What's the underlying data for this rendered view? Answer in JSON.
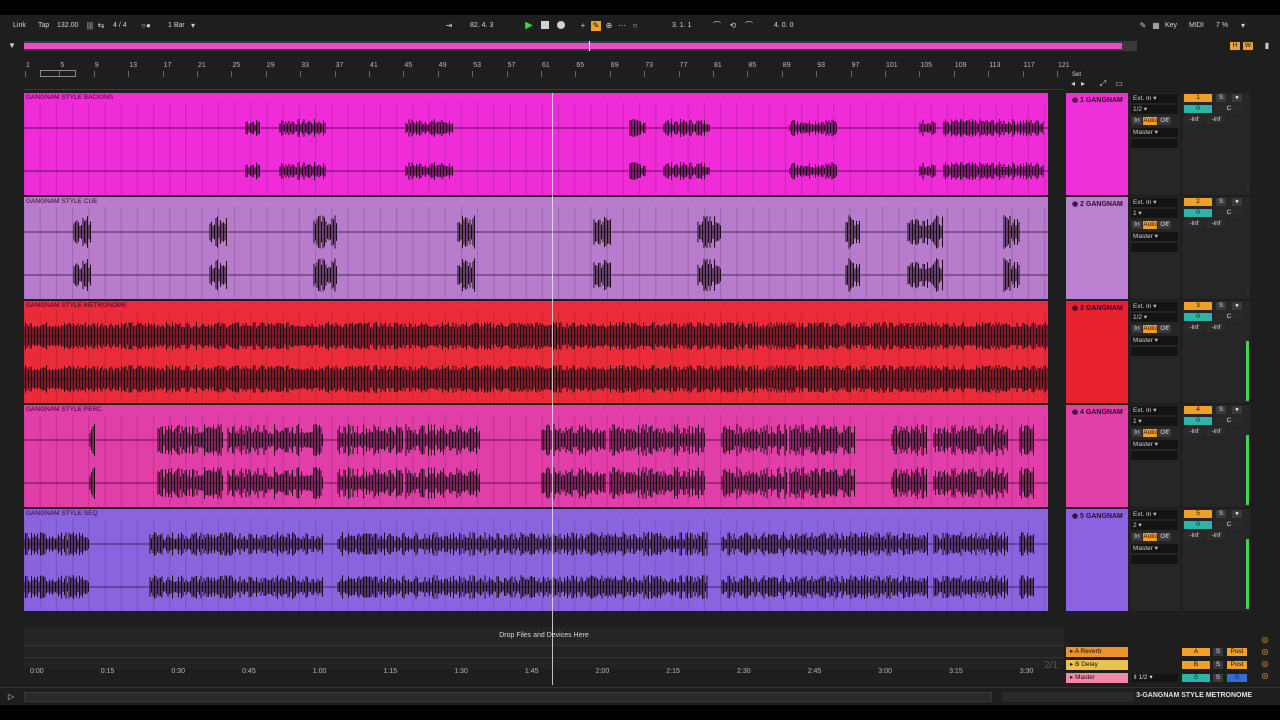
{
  "control_bar": {
    "link": "Link",
    "tap": "Tap",
    "tempo": "132.00",
    "signature": "4 / 4",
    "quantize": "1 Bar",
    "position": "82.  4.  3",
    "loop_start": "3.  1.  1",
    "loop_length": "4.  0.  0",
    "key": "Key",
    "midi": "MIDI",
    "cpu": "7 %"
  },
  "overview_markers": {
    "h": "H",
    "w": "W"
  },
  "ruler": {
    "bars": [
      "1",
      "5",
      "9",
      "13",
      "17",
      "21",
      "25",
      "29",
      "33",
      "37",
      "41",
      "45",
      "49",
      "53",
      "57",
      "61",
      "65",
      "69",
      "73",
      "77",
      "81",
      "85",
      "89",
      "93",
      "97",
      "101",
      "105",
      "109",
      "113",
      "117",
      "121"
    ]
  },
  "set_label": "Set",
  "tracks": [
    {
      "clip_title": "GANGNAM STYLE BACKING",
      "header": "1 GANGNAM",
      "input": "Ext. In",
      "channel": "1/2",
      "monitor": [
        "In",
        "Auto",
        "Off"
      ],
      "output": "Master",
      "number": "1",
      "vol": "0",
      "pan": "C",
      "level_left": "-inf",
      "level_right": "-inf",
      "color": "#ef2cd8",
      "header_color": "#ee31d6"
    },
    {
      "clip_title": "GANGNAM STYLE CUE",
      "header": "2 GANGNAM",
      "input": "Ext. In",
      "channel": "1",
      "monitor": [
        "In",
        "Auto",
        "Off"
      ],
      "output": "Master",
      "number": "2",
      "vol": "0",
      "pan": "C",
      "level_left": "-inf",
      "level_right": "-inf",
      "color": "#b77ccc",
      "header_color": "#bb80cf"
    },
    {
      "clip_title": "GANGNAM STYLE METRONOME",
      "header": "3 GANGNAM",
      "input": "Ext. In",
      "channel": "1/2",
      "monitor": [
        "In",
        "Auto",
        "Off"
      ],
      "output": "Master",
      "number": "3",
      "vol": "0",
      "pan": "C",
      "level_left": "-inf",
      "level_right": "-inf",
      "color": "#ea2b3a",
      "header_color": "#e8212f"
    },
    {
      "clip_title": "GANGNAM STYLE PERC",
      "header": "4 GANGNAM",
      "input": "Ext. In",
      "channel": "1",
      "monitor": [
        "In",
        "Auto",
        "Off"
      ],
      "output": "Master",
      "number": "4",
      "vol": "0",
      "pan": "C",
      "level_left": "-inf",
      "level_right": "-inf",
      "color": "#e13ea8",
      "header_color": "#e040a8"
    },
    {
      "clip_title": "GANGNAM STYLE SEQ",
      "header": "5 GANGNAM",
      "input": "Ext. In",
      "channel": "2",
      "monitor": [
        "In",
        "Auto",
        "Off"
      ],
      "output": "Master",
      "number": "5",
      "vol": "0",
      "pan": "C",
      "level_left": "-inf",
      "level_right": "-inf",
      "color": "#8a64de",
      "header_color": "#8d62e0"
    }
  ],
  "drop_text": "Drop Files and Devices Here",
  "returns": [
    {
      "name": "A Reverb",
      "letter": "A",
      "post": "Post",
      "color": "#f0912c"
    },
    {
      "name": "B Delay",
      "letter": "B",
      "post": "Post",
      "color": "#e8c54a"
    },
    {
      "name": "Master",
      "letter": "0",
      "post": "0",
      "channel": "1/2",
      "color": "#f08aa8"
    }
  ],
  "time_axis": [
    "0:00",
    "0:15",
    "0:30",
    "0:45",
    "1:00",
    "1:15",
    "1:30",
    "1:45",
    "2:00",
    "2:15",
    "2:30",
    "2:45",
    "3:00",
    "3:15",
    "3:30"
  ],
  "page_indicator": "2/1",
  "status": {
    "selected_clip": "3-GANGNAM STYLE METRONOME"
  },
  "colors": {
    "accent_orange": "#f0a028",
    "teal": "#2fb3a8",
    "play_green": "#3cd84a"
  }
}
